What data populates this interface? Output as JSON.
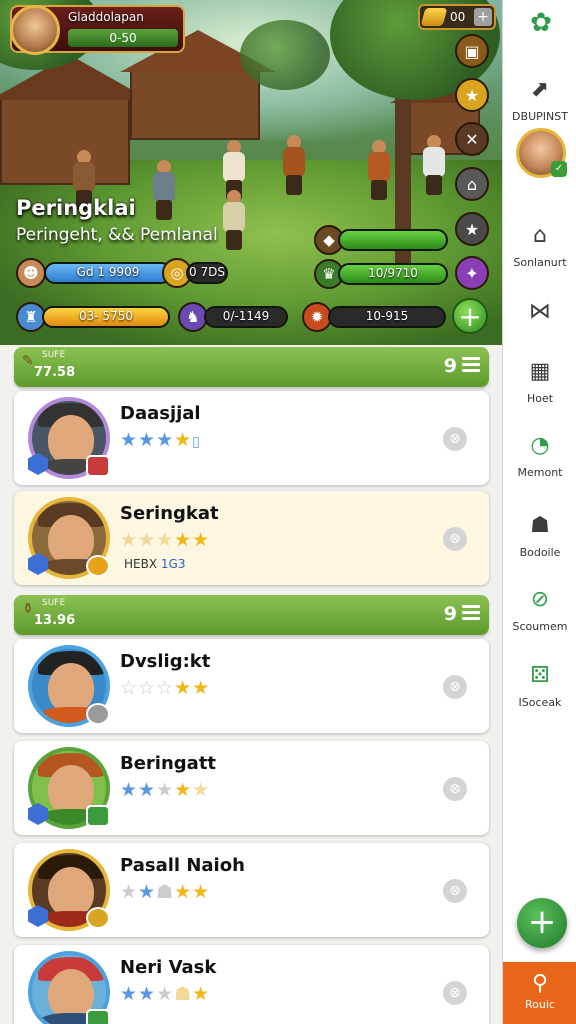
{
  "hud": {
    "player_name": "Gladdolapan",
    "player_sub": "0-50",
    "gold": "00",
    "title": "Peringklai",
    "subtitle": "Peringeht, && Pemlanal",
    "hp_text": "Gd 1 9909",
    "xp_text": "0 7DS",
    "bar_text": "03- 5750",
    "res2_text": "0/-1149",
    "res3_text": "10-915",
    "right_bar1_text": "",
    "right_bar2_text": "10/9710"
  },
  "nav": {
    "items": [
      {
        "label": "DBUPINST",
        "icon": "export-icon"
      },
      {
        "label": "Sonlanurt",
        "icon": "home-icon"
      },
      {
        "label": "",
        "icon": "share-icon"
      },
      {
        "label": "Hoet",
        "icon": "grid-icon"
      },
      {
        "label": "Memont",
        "icon": "clock-icon"
      },
      {
        "label": "Bodoile",
        "icon": "people-icon"
      },
      {
        "label": "Scoumem",
        "icon": "compass-icon"
      },
      {
        "label": "ISoceak",
        "icon": "dice-icon"
      }
    ],
    "bottom_label": "Rouic"
  },
  "groups": [
    {
      "icon": "scroll-icon",
      "line1": "SUFE",
      "line2": "77.58",
      "count": "9"
    },
    {
      "icon": "potion-icon",
      "line1": "SUFE",
      "line2": "13.96",
      "count": "9"
    }
  ],
  "heroes": [
    {
      "name": "Daasjjal",
      "stars": [
        "blue",
        "blue",
        "blue",
        "gold"
      ],
      "tag": "",
      "tag_b": ""
    },
    {
      "name": "Seringkat",
      "stars": [
        "light",
        "light",
        "light",
        "gold",
        "gold"
      ],
      "tag": "HEBX",
      "tag_b": "1G3"
    },
    {
      "name": "Dvslig:kt",
      "stars": [
        "dim",
        "dim",
        "dim",
        "gold",
        "gold"
      ],
      "tag": "",
      "tag_b": ""
    },
    {
      "name": "Beringatt",
      "stars": [
        "blue",
        "blue",
        "dim",
        "gold",
        "light"
      ],
      "tag": "",
      "tag_b": ""
    },
    {
      "name": "Pasall Naioh",
      "stars": [
        "dim",
        "blue",
        "dim",
        "gold",
        "gold"
      ],
      "tag": "",
      "tag_b": ""
    },
    {
      "name": "Neri Vask",
      "stars": [
        "blue",
        "blue",
        "dim",
        "light",
        "gold"
      ],
      "tag": "",
      "tag_b": ""
    }
  ],
  "colors": {
    "accent_green": "#5c9a2c",
    "nav_bottom": "#e8651a",
    "highlight_card": "#fdf6e0"
  }
}
